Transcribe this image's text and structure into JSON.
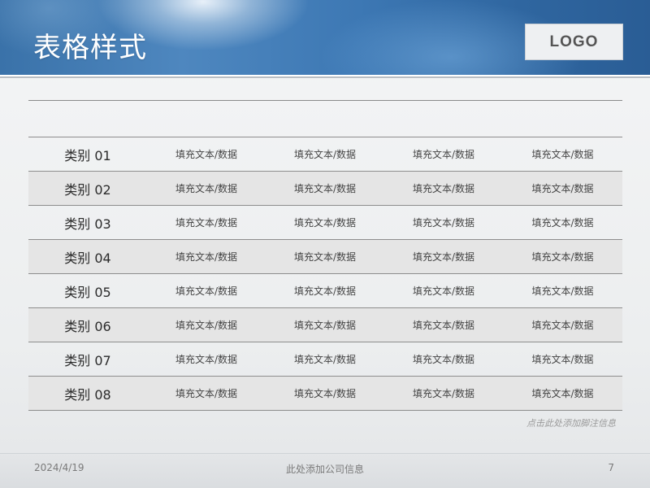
{
  "header": {
    "title": "表格样式",
    "logo": "LOGO"
  },
  "table": {
    "rows": [
      {
        "category": "类别 01",
        "cells": [
          "填充文本/数据",
          "填充文本/数据",
          "填充文本/数据",
          "填充文本/数据"
        ]
      },
      {
        "category": "类别 02",
        "cells": [
          "填充文本/数据",
          "填充文本/数据",
          "填充文本/数据",
          "填充文本/数据"
        ]
      },
      {
        "category": "类别 03",
        "cells": [
          "填充文本/数据",
          "填充文本/数据",
          "填充文本/数据",
          "填充文本/数据"
        ]
      },
      {
        "category": "类别 04",
        "cells": [
          "填充文本/数据",
          "填充文本/数据",
          "填充文本/数据",
          "填充文本/数据"
        ]
      },
      {
        "category": "类别 05",
        "cells": [
          "填充文本/数据",
          "填充文本/数据",
          "填充文本/数据",
          "填充文本/数据"
        ]
      },
      {
        "category": "类别 06",
        "cells": [
          "填充文本/数据",
          "填充文本/数据",
          "填充文本/数据",
          "填充文本/数据"
        ]
      },
      {
        "category": "类别 07",
        "cells": [
          "填充文本/数据",
          "填充文本/数据",
          "填充文本/数据",
          "填充文本/数据"
        ]
      },
      {
        "category": "类别 08",
        "cells": [
          "填充文本/数据",
          "填充文本/数据",
          "填充文本/数据",
          "填充文本/数据"
        ]
      }
    ]
  },
  "footnote": "点击此处添加脚注信息",
  "footer": {
    "date": "2024/4/19",
    "company": "此处添加公司信息",
    "page": "7"
  },
  "colors": {
    "header_blue": "#3d78b4",
    "row_alt": "#e5e5e5",
    "rule": "#8d8d8d"
  }
}
